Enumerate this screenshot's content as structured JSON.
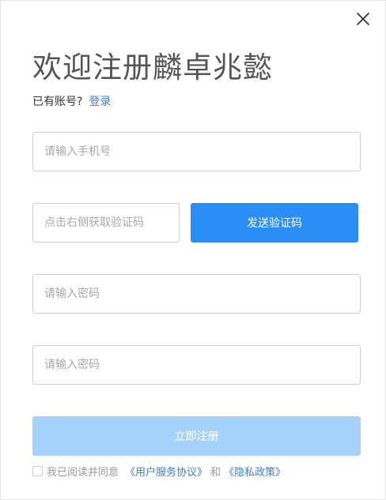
{
  "dialog": {
    "title": "欢迎注册麟卓兆懿",
    "close_icon": "close-icon"
  },
  "login": {
    "prompt": "已有账号?",
    "link": "登录"
  },
  "form": {
    "phone_placeholder": "请输入手机号",
    "code_placeholder": "点击右侧获取验证码",
    "send_code_label": "发送验证码",
    "password_placeholder": "请输入密码",
    "confirm_password_placeholder": "请输入密码",
    "register_label": "立即注册"
  },
  "agreement": {
    "text": "我已阅读并同意",
    "user_agreement": "《用户服务协议》",
    "and": "和",
    "privacy_policy": "《隐私政策》",
    "checked": false
  },
  "colors": {
    "primary": "#2b8ef6",
    "primary_disabled": "#a6d3fb",
    "link": "#3b7ed8"
  }
}
